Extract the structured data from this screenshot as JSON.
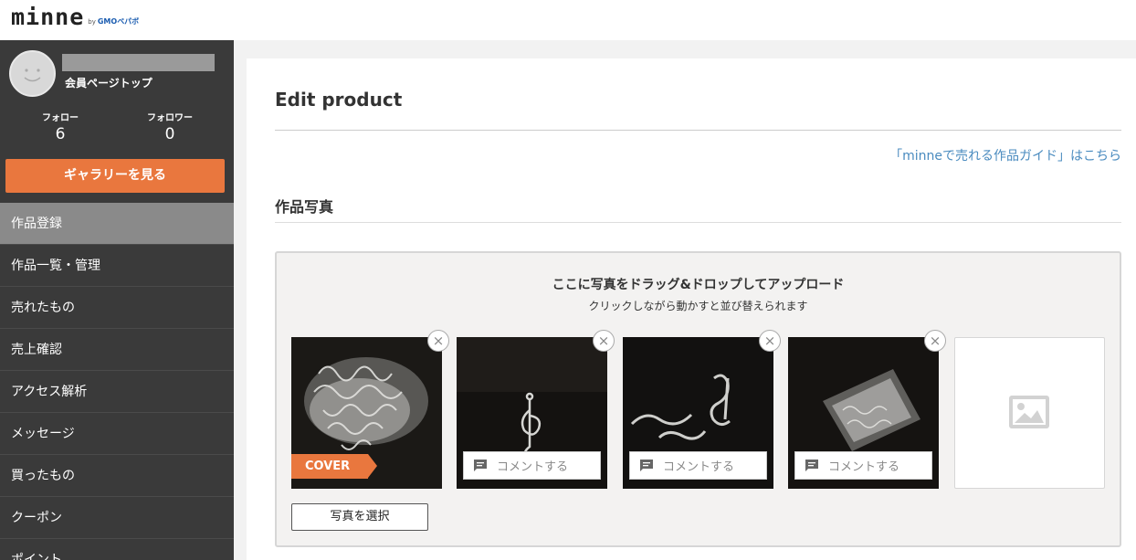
{
  "header": {
    "logo_text": "minne",
    "logo_by": "by",
    "logo_company": "GMOペパボ"
  },
  "sidebar": {
    "mypage_link": "会員ページトップ",
    "follow_label": "フォロー",
    "follow_count": "6",
    "follower_label": "フォロワー",
    "follower_count": "0",
    "gallery_button": "ギャラリーを見る",
    "items": [
      {
        "label": "作品登録",
        "active": true
      },
      {
        "label": "作品一覧・管理"
      },
      {
        "label": "売れたもの"
      },
      {
        "label": "売上確認"
      },
      {
        "label": "アクセス解析"
      },
      {
        "label": "メッセージ"
      },
      {
        "label": "買ったもの"
      },
      {
        "label": "クーポン"
      },
      {
        "label": "ポイント"
      }
    ]
  },
  "main": {
    "title": "Edit product",
    "guide_link": "「minneで売れる作品ガイド」はこちら",
    "photos_section_title": "作品写真",
    "dropzone_title": "ここに写真をドラッグ&ドロップしてアップロード",
    "dropzone_subtitle": "クリックしながら動かすと並び替えられます",
    "cover_label": "COVER",
    "comment_placeholder": "コメントする",
    "remove_symbol": "×",
    "select_photo_button": "写真を選択"
  },
  "colors": {
    "accent": "#e9773e",
    "sidebar_bg": "#3a3a3a",
    "link": "#4a8bbf"
  }
}
